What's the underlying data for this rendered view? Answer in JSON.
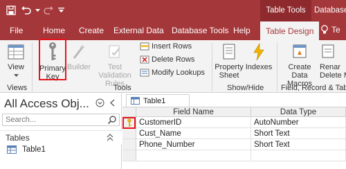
{
  "titlebar": {
    "contextual_tab_group": "Table Tools",
    "database_name": "Database"
  },
  "tabs": [
    {
      "label": "File"
    },
    {
      "label": "Home"
    },
    {
      "label": "Create"
    },
    {
      "label": "External Data"
    },
    {
      "label": "Database Tools"
    },
    {
      "label": "Help"
    },
    {
      "label": "Table Design",
      "active": true
    }
  ],
  "tell_me": "Te",
  "ribbon": {
    "view": "View",
    "primary_key": "Primary Key",
    "primary_key_line1": "Primary",
    "primary_key_line2": "Key",
    "builder": "Builder",
    "test_validation_line1": "Test Validation",
    "test_validation_line2": "Rules",
    "insert_rows": "Insert Rows",
    "delete_rows": "Delete Rows",
    "modify_lookups": "Modify Lookups",
    "property_sheet_line1": "Property",
    "property_sheet_line2": "Sheet",
    "indexes": "Indexes",
    "create_data_macros_line1": "Create Data",
    "create_data_macros_line2": "Macros",
    "rename_delete_macro_line1": "Renar",
    "rename_delete_macro_line2": "Delete M",
    "groups": {
      "views": "Views",
      "tools": "Tools",
      "show_hide": "Show/Hide",
      "field_record_table": "Field, Record & Table"
    }
  },
  "nav": {
    "title": "All Access Obj...",
    "search_placeholder": "Search...",
    "section": "Tables",
    "items": [
      {
        "label": "Table1"
      }
    ]
  },
  "document": {
    "tab_label": "Table1",
    "columns": [
      "Field Name",
      "Data Type"
    ],
    "rows": [
      {
        "field": "CustomerID",
        "type": "AutoNumber",
        "primary_key": true
      },
      {
        "field": "Cust_Name",
        "type": "Short Text"
      },
      {
        "field": "Phone_Number",
        "type": "Short Text"
      }
    ]
  },
  "colors": {
    "accent": "#a4373a",
    "highlight_border": "#e8121b"
  }
}
